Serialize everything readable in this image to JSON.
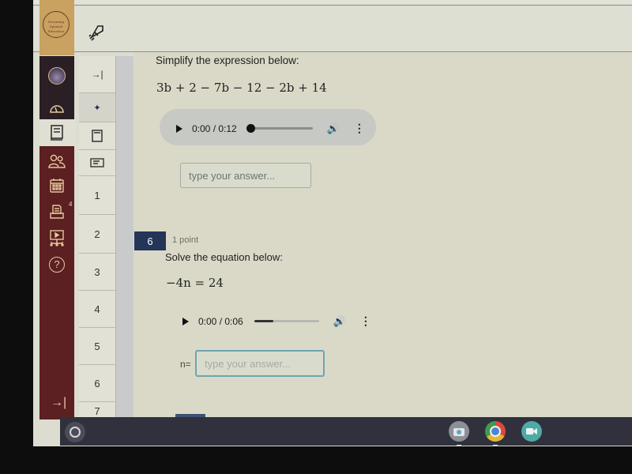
{
  "header": {
    "logo_text": "Dreaming Spanish Education",
    "rocket_icon": "rocket-icon"
  },
  "left_nav": {
    "items": [
      {
        "name": "profile-avatar",
        "icon": "avatar-icon"
      },
      {
        "name": "dashboard",
        "icon": "speedometer-icon"
      },
      {
        "name": "courses",
        "icon": "book-icon",
        "active": true
      },
      {
        "name": "people",
        "icon": "users-icon"
      },
      {
        "name": "calendar",
        "icon": "calendar-icon"
      },
      {
        "name": "inbox",
        "icon": "inbox-icon",
        "badge": "4"
      },
      {
        "name": "media",
        "icon": "presentation-icon"
      },
      {
        "name": "help",
        "icon": "help-icon"
      }
    ],
    "expand_glyph": "→|"
  },
  "sub_nav": {
    "collapse_glyph": "→|",
    "pin_glyph": "📌",
    "numbers": [
      "1",
      "2",
      "3",
      "4",
      "5",
      "6",
      "7"
    ]
  },
  "question5": {
    "prompt": "Simplify the expression below:",
    "expression": "3b + 2 − 7b − 12 − 2b + 14",
    "audio": {
      "time": "0:00 / 0:12",
      "progress": 0.0
    },
    "answer_placeholder": "type your answer..."
  },
  "question6": {
    "number": "6",
    "points": "1 point",
    "prompt": "Solve the equation below:",
    "equation": "−4n = 24",
    "audio": {
      "time": "0:00 / 0:06",
      "buffered": 0.3
    },
    "answer_label": "n=",
    "answer_placeholder": "type your answer..."
  },
  "shelf": {
    "apps": [
      {
        "name": "camera",
        "icon": "camera-icon",
        "color": "#8c8f96"
      },
      {
        "name": "chrome",
        "icon": "chrome-icon",
        "color": "#d5a83a"
      },
      {
        "name": "meet",
        "icon": "video-camera-icon",
        "color": "#4eaaa5"
      }
    ]
  }
}
